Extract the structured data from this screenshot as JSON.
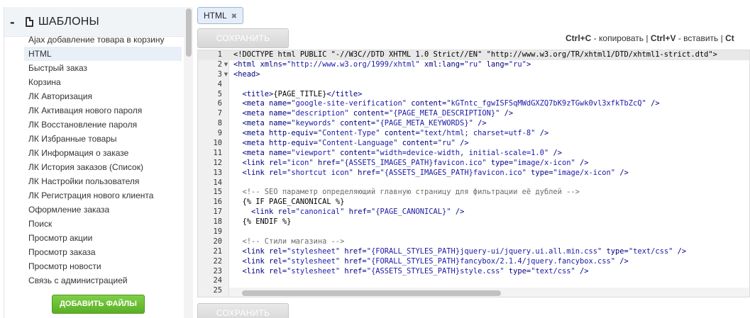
{
  "sidebar": {
    "collapse_symbol": "-",
    "title": "ШАБЛОНЫ",
    "items": [
      {
        "label": "Ajax добавление товара в корзину",
        "active": false
      },
      {
        "label": "HTML",
        "active": true
      },
      {
        "label": "Быстрый заказ",
        "active": false
      },
      {
        "label": "Корзина",
        "active": false
      },
      {
        "label": "ЛК Авторизация",
        "active": false
      },
      {
        "label": "ЛК Активация нового пароля",
        "active": false
      },
      {
        "label": "ЛК Восстановление пароля",
        "active": false
      },
      {
        "label": "ЛК Избранные товары",
        "active": false
      },
      {
        "label": "ЛК Информация о заказе",
        "active": false
      },
      {
        "label": "ЛК История заказов (Список)",
        "active": false
      },
      {
        "label": "ЛК Настройки пользователя",
        "active": false
      },
      {
        "label": "ЛК Регистрация нового клиента",
        "active": false
      },
      {
        "label": "Оформление заказа",
        "active": false
      },
      {
        "label": "Поиск",
        "active": false
      },
      {
        "label": "Просмотр акции",
        "active": false
      },
      {
        "label": "Просмотр заказа",
        "active": false
      },
      {
        "label": "Просмотр новости",
        "active": false
      },
      {
        "label": "Связь с администрацией",
        "active": false
      }
    ],
    "add_files_label": "ДОБАВИТЬ ФАЙЛЫ",
    "add_files_color": "#6cbf36"
  },
  "tab": {
    "label": "HTML",
    "close_symbol": "✖"
  },
  "toolbar": {
    "save_label": "СОХРАНИТЬ",
    "shortcuts": {
      "copy_key": "Ctrl+C",
      "copy_text": " - копировать | ",
      "paste_key": "Ctrl+V",
      "paste_text": " - вставить | ",
      "trail_key": "Ct"
    }
  },
  "editor": {
    "active_line": 1,
    "lines": [
      {
        "n": 1,
        "fold": "",
        "parts": [
          [
            "pl",
            "<!DOCTYPE html PUBLIC \"-//W3C//DTD XHTML 1.0 Strict//EN\" \"http://www.w3.org/TR/xhtml1/DTD/xhtml1-strict.dtd\">"
          ]
        ]
      },
      {
        "n": 2,
        "fold": "▼",
        "parts": [
          [
            "t",
            "<html "
          ],
          [
            "a",
            "xmlns="
          ],
          [
            "v",
            "\"http://www.w3.org/1999/xhtml\""
          ],
          [
            "a",
            " xml:lang="
          ],
          [
            "v",
            "\"ru\""
          ],
          [
            "a",
            " lang="
          ],
          [
            "v",
            "\"ru\""
          ],
          [
            "t",
            ">"
          ]
        ]
      },
      {
        "n": 3,
        "fold": "▼",
        "parts": [
          [
            "t",
            "<head>"
          ]
        ]
      },
      {
        "n": 4,
        "fold": "",
        "parts": [
          [
            "pl",
            ""
          ]
        ]
      },
      {
        "n": 5,
        "fold": "",
        "parts": [
          [
            "t",
            "  <title>"
          ],
          [
            "pl",
            "{PAGE_TITLE}"
          ],
          [
            "t",
            "</title>"
          ]
        ]
      },
      {
        "n": 6,
        "fold": "",
        "parts": [
          [
            "t",
            "  <meta "
          ],
          [
            "a",
            "name="
          ],
          [
            "v",
            "\"google-site-verification\""
          ],
          [
            "a",
            " content="
          ],
          [
            "v",
            "\"kGTntc_fgwISFSqMWdGXZQ7bK9zTGwk0vl3xfkTbZcQ\""
          ],
          [
            "t",
            " />"
          ]
        ]
      },
      {
        "n": 7,
        "fold": "",
        "parts": [
          [
            "t",
            "  <meta "
          ],
          [
            "a",
            "name="
          ],
          [
            "v",
            "\"description\""
          ],
          [
            "a",
            " content="
          ],
          [
            "v",
            "\"{PAGE_META_DESCRIPTION}\""
          ],
          [
            "t",
            " />"
          ]
        ]
      },
      {
        "n": 8,
        "fold": "",
        "parts": [
          [
            "t",
            "  <meta "
          ],
          [
            "a",
            "name="
          ],
          [
            "v",
            "\"keywords\""
          ],
          [
            "a",
            " content="
          ],
          [
            "v",
            "\"{PAGE_META_KEYWORDS}\""
          ],
          [
            "t",
            " />"
          ]
        ]
      },
      {
        "n": 9,
        "fold": "",
        "parts": [
          [
            "t",
            "  <meta "
          ],
          [
            "a",
            "http-equiv="
          ],
          [
            "v",
            "\"Content-Type\""
          ],
          [
            "a",
            " content="
          ],
          [
            "v",
            "\"text/html; charset=utf-8\""
          ],
          [
            "t",
            " />"
          ]
        ]
      },
      {
        "n": 10,
        "fold": "",
        "parts": [
          [
            "t",
            "  <meta "
          ],
          [
            "a",
            "http-equiv="
          ],
          [
            "v",
            "\"Content-Language\""
          ],
          [
            "a",
            " content="
          ],
          [
            "v",
            "\"ru\""
          ],
          [
            "t",
            " />"
          ]
        ]
      },
      {
        "n": 11,
        "fold": "",
        "parts": [
          [
            "t",
            "  <meta "
          ],
          [
            "a",
            "name="
          ],
          [
            "v",
            "\"viewport\""
          ],
          [
            "a",
            " content="
          ],
          [
            "v",
            "\"width=device-width, initial-scale=1.0\""
          ],
          [
            "t",
            " />"
          ]
        ]
      },
      {
        "n": 12,
        "fold": "",
        "parts": [
          [
            "t",
            "  <link "
          ],
          [
            "a",
            "rel="
          ],
          [
            "v",
            "\"icon\""
          ],
          [
            "a",
            " href="
          ],
          [
            "v",
            "\"{ASSETS_IMAGES_PATH}favicon.ico\""
          ],
          [
            "a",
            " type="
          ],
          [
            "v",
            "\"image/x-icon\""
          ],
          [
            "t",
            " />"
          ]
        ]
      },
      {
        "n": 13,
        "fold": "",
        "parts": [
          [
            "t",
            "  <link "
          ],
          [
            "a",
            "rel="
          ],
          [
            "v",
            "\"shortcut icon\""
          ],
          [
            "a",
            " href="
          ],
          [
            "v",
            "\"{ASSETS_IMAGES_PATH}favicon.ico\""
          ],
          [
            "a",
            " type="
          ],
          [
            "v",
            "\"image/x-icon\""
          ],
          [
            "t",
            " />"
          ]
        ]
      },
      {
        "n": 14,
        "fold": "",
        "parts": [
          [
            "pl",
            ""
          ]
        ]
      },
      {
        "n": 15,
        "fold": "",
        "parts": [
          [
            "c",
            "  <!-- SEO параметр определяющий главную страницу для фильтрации её дублей -->"
          ]
        ]
      },
      {
        "n": 16,
        "fold": "",
        "parts": [
          [
            "pl",
            "  {% IF PAGE_CANONICAL %}"
          ]
        ]
      },
      {
        "n": 17,
        "fold": "",
        "parts": [
          [
            "t",
            "    <link "
          ],
          [
            "a",
            "rel="
          ],
          [
            "v",
            "\"canonical\""
          ],
          [
            "a",
            " href="
          ],
          [
            "v",
            "\"{PAGE_CANONICAL}\""
          ],
          [
            "t",
            " />"
          ]
        ]
      },
      {
        "n": 18,
        "fold": "",
        "parts": [
          [
            "pl",
            "  {% ENDIF %}"
          ]
        ]
      },
      {
        "n": 19,
        "fold": "",
        "parts": [
          [
            "pl",
            ""
          ]
        ]
      },
      {
        "n": 20,
        "fold": "",
        "parts": [
          [
            "c",
            "  <!-- Стили магазина -->"
          ]
        ]
      },
      {
        "n": 21,
        "fold": "",
        "parts": [
          [
            "t",
            "  <link "
          ],
          [
            "a",
            "rel="
          ],
          [
            "v",
            "\"stylesheet\""
          ],
          [
            "a",
            " href="
          ],
          [
            "v",
            "\"{FORALL_STYLES_PATH}jquery-ui/jquery.ui.all.min.css\""
          ],
          [
            "a",
            " type="
          ],
          [
            "v",
            "\"text/css\""
          ],
          [
            "t",
            " />"
          ]
        ]
      },
      {
        "n": 22,
        "fold": "",
        "parts": [
          [
            "t",
            "  <link "
          ],
          [
            "a",
            "rel="
          ],
          [
            "v",
            "\"stylesheet\""
          ],
          [
            "a",
            " href="
          ],
          [
            "v",
            "\"{FORALL_STYLES_PATH}fancybox/2.1.4/jquery.fancybox.css\""
          ],
          [
            "t",
            " />"
          ]
        ]
      },
      {
        "n": 23,
        "fold": "",
        "parts": [
          [
            "t",
            "  <link "
          ],
          [
            "a",
            "rel="
          ],
          [
            "v",
            "\"stylesheet\""
          ],
          [
            "a",
            " href="
          ],
          [
            "v",
            "\"{ASSETS_STYLES_PATH}style.css\""
          ],
          [
            "a",
            " type="
          ],
          [
            "v",
            "\"text/css\""
          ],
          [
            "t",
            " />"
          ]
        ]
      },
      {
        "n": 24,
        "fold": "",
        "parts": [
          [
            "pl",
            ""
          ]
        ]
      },
      {
        "n": 25,
        "fold": "",
        "parts": [
          [
            "pl",
            ""
          ]
        ]
      }
    ]
  }
}
